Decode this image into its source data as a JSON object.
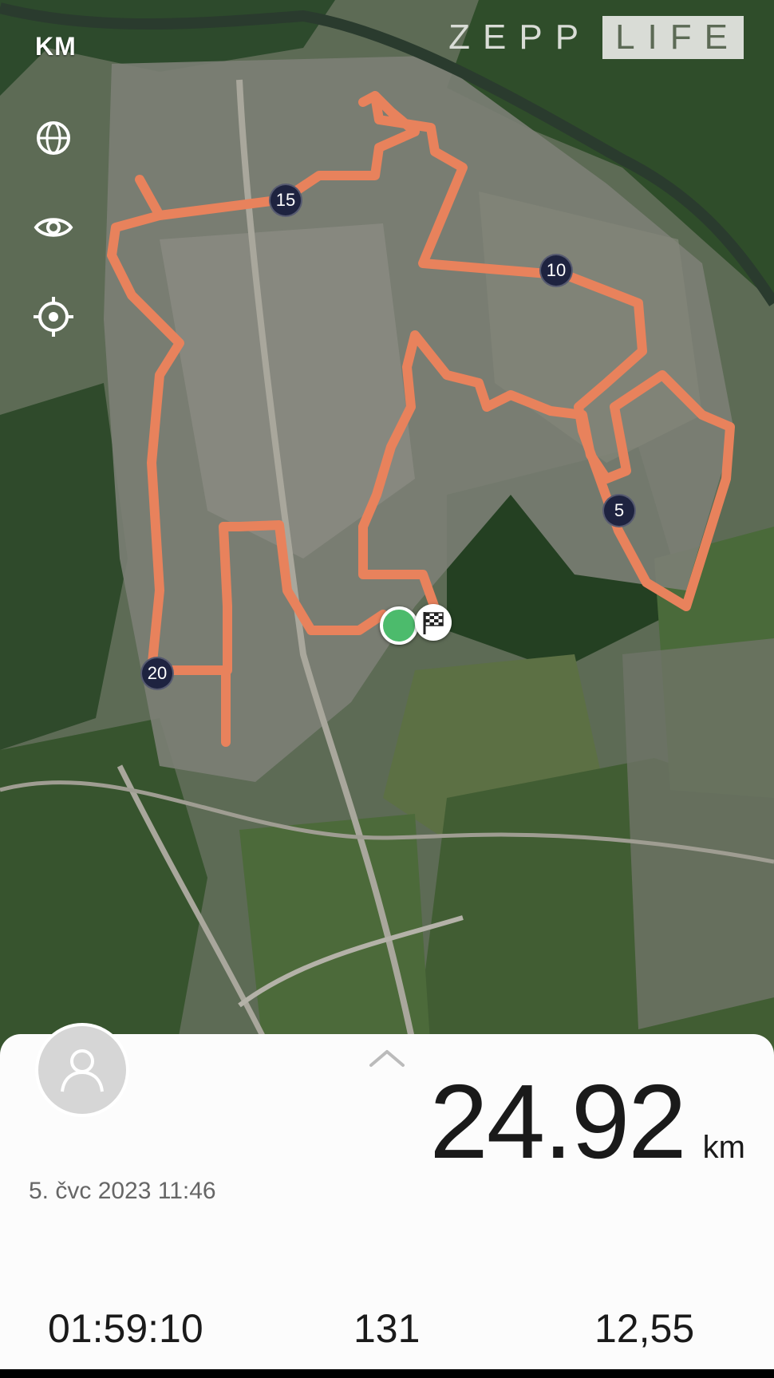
{
  "map": {
    "unit_toggle": "KM",
    "logo": {
      "part1": "ZEPP",
      "part2": "LIFE"
    },
    "km_markers": [
      "5",
      "10",
      "15",
      "20"
    ],
    "colors": {
      "route": "#e8825c",
      "marker_bg": "#1e2340",
      "start": "#4cbb6c"
    }
  },
  "summary": {
    "distance_value": "24.92",
    "distance_unit": "km",
    "datetime": "5. čvc 2023 11:46",
    "duration": "01:59:10",
    "stat_middle": "131",
    "stat_right": "12,55"
  }
}
